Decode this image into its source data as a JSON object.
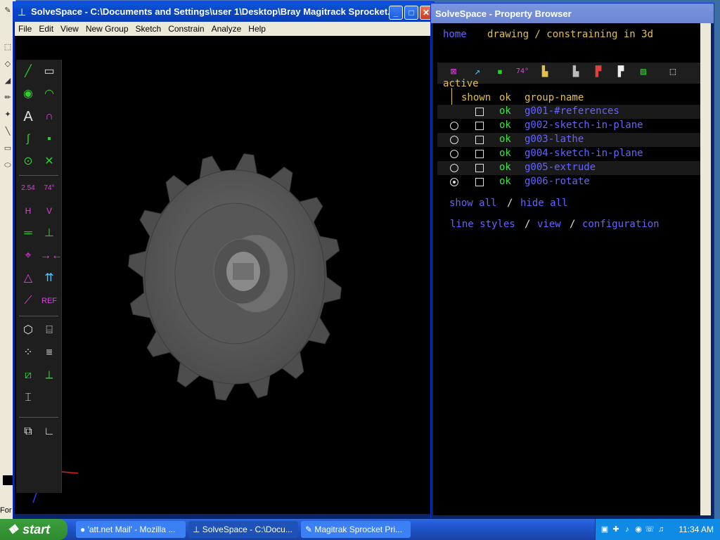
{
  "bg_app": {
    "status_text": "For"
  },
  "main_window": {
    "title": "SolveSpace - C:\\Documents and Settings\\user 1\\Desktop\\Bray Magitrack Sprocket...",
    "menu": [
      "File",
      "Edit",
      "View",
      "New Group",
      "Sketch",
      "Constrain",
      "Analyze",
      "Help"
    ],
    "toolbar_labels": {
      "dim": "2.54",
      "angle": "74°",
      "h": "H",
      "v": "V",
      "ref": "REF"
    }
  },
  "property_browser": {
    "title": "SolveSpace - Property Browser",
    "nav": {
      "home": "home",
      "mode": "drawing / constraining in 3d"
    },
    "section_label": "active",
    "headers": {
      "shown": "shown",
      "ok": "ok",
      "group_name": "group-name"
    },
    "groups": [
      {
        "ok": "ok",
        "name": "g001-#references",
        "active": false,
        "has_radio": false
      },
      {
        "ok": "ok",
        "name": "g002-sketch-in-plane",
        "active": false,
        "has_radio": true
      },
      {
        "ok": "ok",
        "name": "g003-lathe",
        "active": false,
        "has_radio": true
      },
      {
        "ok": "ok",
        "name": "g004-sketch-in-plane",
        "active": false,
        "has_radio": true
      },
      {
        "ok": "ok",
        "name": "g005-extrude",
        "active": false,
        "has_radio": true
      },
      {
        "ok": "ok",
        "name": "g006-rotate",
        "active": true,
        "has_radio": true
      }
    ],
    "show_all": "show all",
    "slash": "/",
    "hide_all": "hide all",
    "line_styles": "line styles",
    "view": "view",
    "configuration": "configuration",
    "icon_label_angle": "74°"
  },
  "taskbar": {
    "start": "start",
    "tasks": [
      {
        "label": "'att.net Mail' - Mozilla ..."
      },
      {
        "label": "SolveSpace - C:\\Docu..."
      },
      {
        "label": "Magitrak Sprocket Pri..."
      }
    ],
    "clock": "11:34 AM"
  },
  "colors": {
    "accent": "#0a246a",
    "link": "#6464ff",
    "ok_green": "#40e040",
    "label_yellow": "#e0c050"
  }
}
